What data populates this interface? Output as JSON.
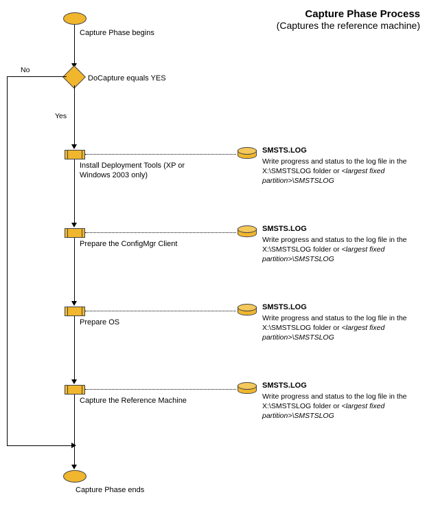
{
  "title": {
    "line1": "Capture Phase Process",
    "line2": "(Captures the reference machine)"
  },
  "start": {
    "label": "Capture Phase begins"
  },
  "decision": {
    "label": "DoCapture equals YES",
    "yes": "Yes",
    "no": "No"
  },
  "steps": [
    {
      "label": "Install Deployment Tools (XP or Windows 2003 only)"
    },
    {
      "label": "Prepare the ConfigMgr Client"
    },
    {
      "label": "Prepare OS"
    },
    {
      "label": "Capture the Reference Machine"
    }
  ],
  "log": {
    "title": "SMSTS.LOG",
    "desc1": "Write progress and status to the log file in the X:\\SMSTSLOG folder or ",
    "desc2": "<largest fixed partition>",
    "desc3": "\\SMSTSLOG"
  },
  "end": {
    "label": "Capture Phase ends"
  }
}
